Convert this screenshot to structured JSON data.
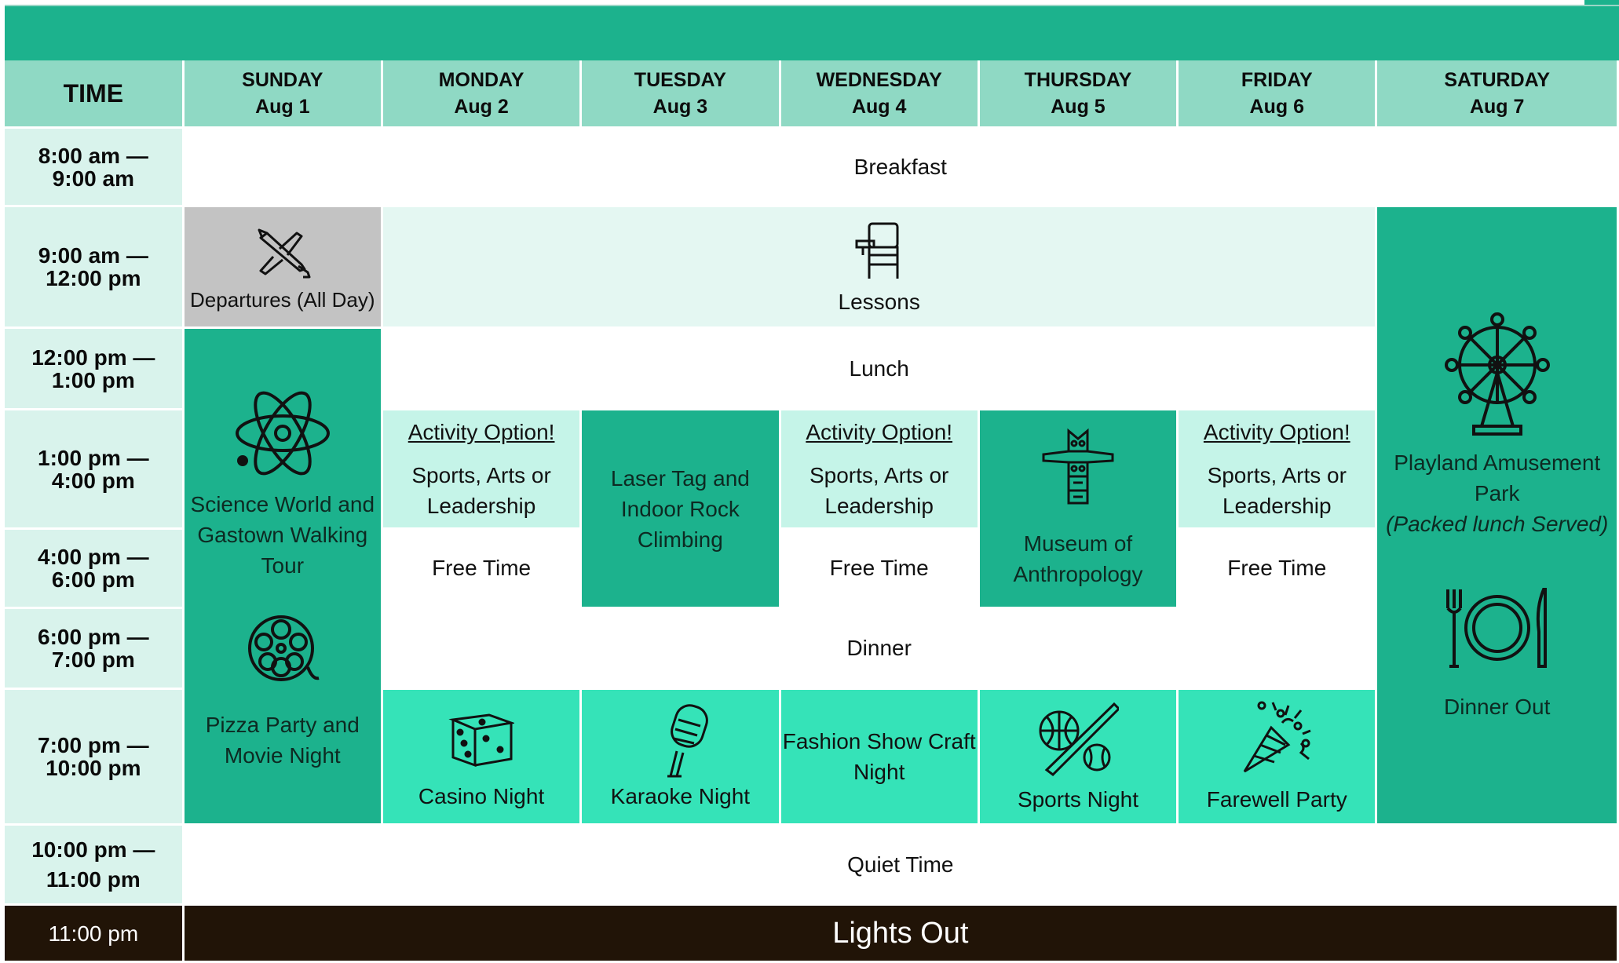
{
  "header": {
    "time_label": "TIME",
    "days": [
      {
        "name": "SUNDAY",
        "date": "Aug 1"
      },
      {
        "name": "MONDAY",
        "date": "Aug 2"
      },
      {
        "name": "TUESDAY",
        "date": "Aug 3"
      },
      {
        "name": "WEDNESDAY",
        "date": "Aug 4"
      },
      {
        "name": "THURSDAY",
        "date": "Aug 5"
      },
      {
        "name": "FRIDAY",
        "date": "Aug 6"
      },
      {
        "name": "SATURDAY",
        "date": "Aug 7"
      }
    ]
  },
  "times": [
    {
      "start": "8:00 am —",
      "end": "9:00 am"
    },
    {
      "start": "9:00 am —",
      "end": "12:00 pm"
    },
    {
      "start": "12:00 pm —",
      "end": "1:00 pm"
    },
    {
      "start": "1:00 pm —",
      "end": "4:00 pm"
    },
    {
      "start": "4:00 pm —",
      "end": "6:00 pm"
    },
    {
      "start": "6:00 pm —",
      "end": "7:00 pm"
    },
    {
      "start": "7:00 pm —",
      "end": "10:00 pm"
    },
    {
      "start": "10:00 pm —",
      "end": "11:00 pm"
    },
    {
      "start": "11:00 pm",
      "end": ""
    }
  ],
  "events": {
    "breakfast": "Breakfast",
    "departures": "Departures (All Day)",
    "lessons": "Lessons",
    "lunch": "Lunch",
    "dinner": "Dinner",
    "quiet_time": "Quiet Time",
    "lights_out": "Lights Out",
    "science_world": "Science World and Gastown Walking Tour",
    "pizza_party": "Pizza Party and Movie Night",
    "playland": "Playland Amusement Park",
    "playland_note": "(Packed lunch Served)",
    "dinner_out": "Dinner Out",
    "activity_title": "Activity Option!",
    "activity_desc": "Sports, Arts or Leadership",
    "free_time": "Free Time",
    "laser_tag": "Laser Tag and Indoor Rock Climbing",
    "museum": "Museum of Anthropology",
    "casino": "Casino Night",
    "karaoke": "Karaoke Night",
    "fashion": "Fashion Show Craft Night",
    "sports_night": "Sports Night",
    "farewell": "Farewell Party"
  },
  "colors": {
    "header_bar": "#1cb28d",
    "day_header": "#8fd9c4",
    "time_col": "#d9f3ec",
    "activity_green": "#1cb28d",
    "activity_mint": "#c5f4e8",
    "evening_bright": "#35e3b8",
    "departures_gray": "#c3c3c3",
    "lights_out": "#211407"
  },
  "icons": [
    "airplane-icon",
    "school-desk-icon",
    "atom-icon",
    "film-reel-icon",
    "ferris-wheel-icon",
    "plate-cutlery-icon",
    "totem-pole-icon",
    "dice-icon",
    "microphone-icon",
    "sports-balls-icon",
    "party-popper-icon"
  ]
}
